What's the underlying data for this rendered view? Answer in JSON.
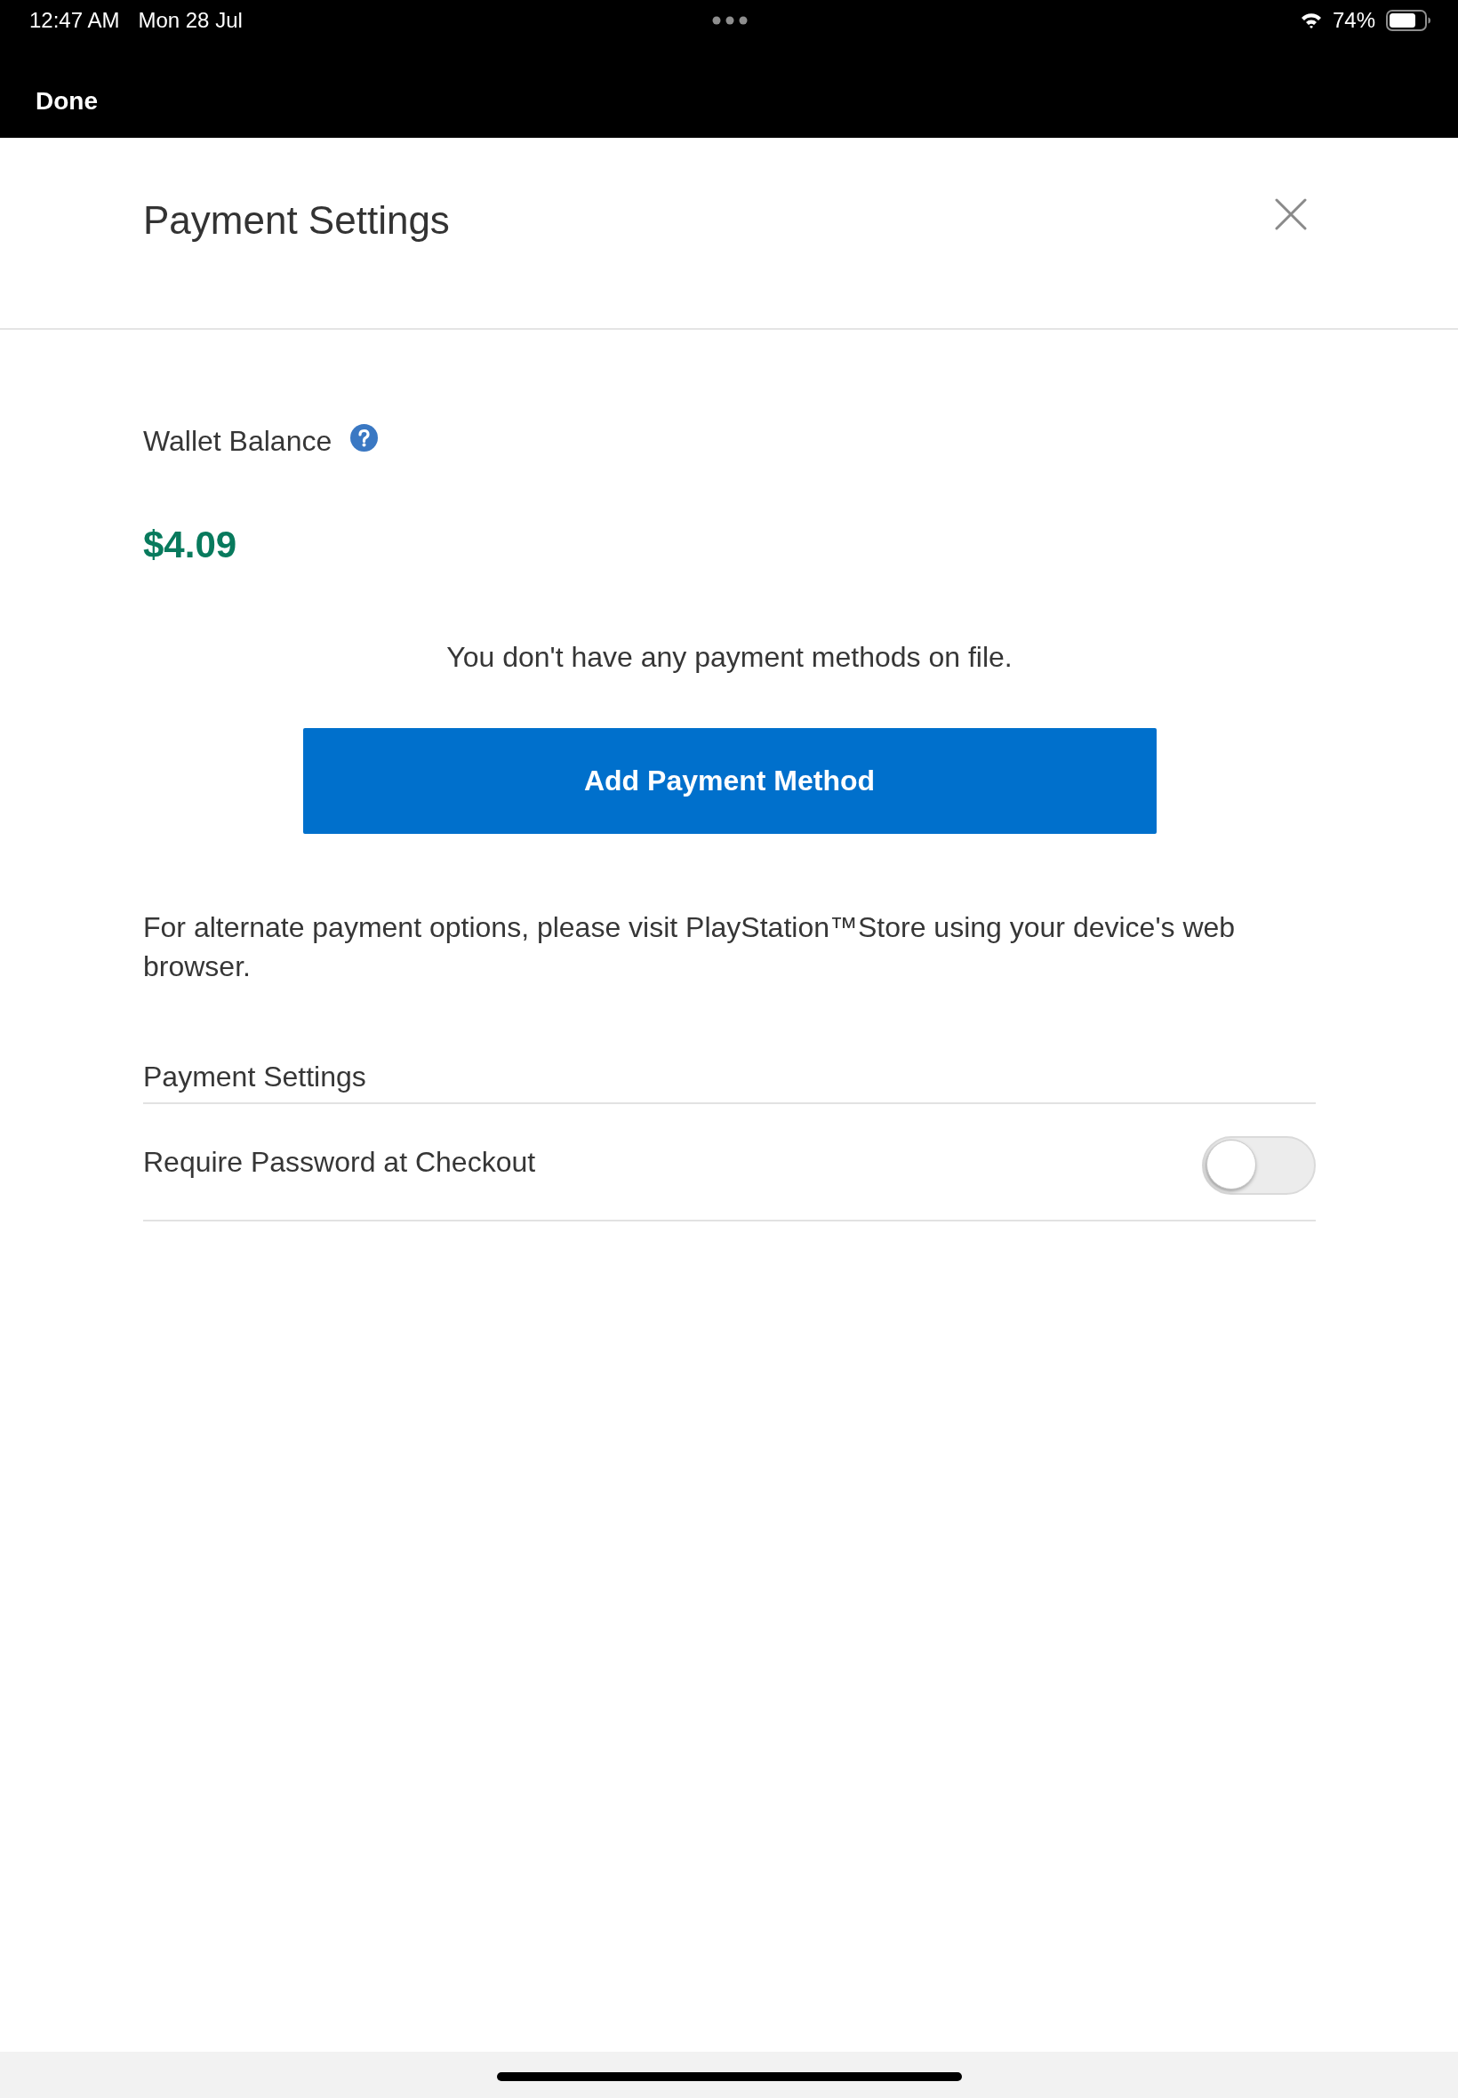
{
  "status_bar": {
    "time": "12:47 AM",
    "date": "Mon 28 Jul",
    "battery": "74%"
  },
  "nav_bar": {
    "done": "Done"
  },
  "header": {
    "title": "Payment Settings"
  },
  "wallet": {
    "label": "Wallet Balance",
    "balance": "$4.09"
  },
  "payment_methods": {
    "empty_message": "You don't have any payment methods on file.",
    "add_button": "Add Payment Method"
  },
  "note": "For alternate payment options, please visit PlayStation™Store using your device's web browser.",
  "settings": {
    "title": "Payment Settings",
    "items": [
      {
        "kind": "toggle",
        "label": "Require Password at Checkout",
        "on": false
      }
    ]
  }
}
